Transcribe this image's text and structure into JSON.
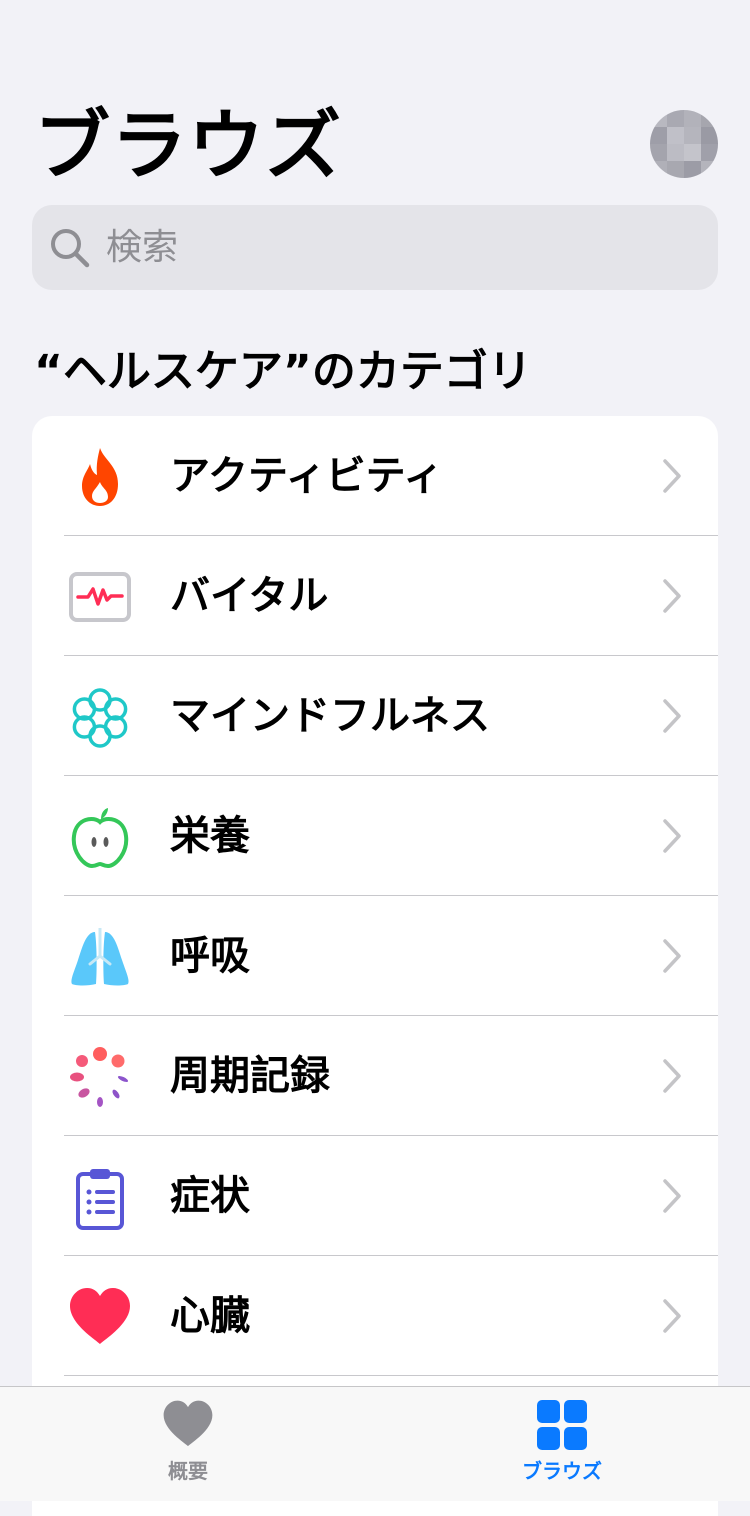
{
  "header": {
    "title": "ブラウズ",
    "avatar_colors": [
      "#b8b8c0",
      "#a9a9b2",
      "#b2b2ba",
      "#a6a6ae",
      "#9e9ea8",
      "#c0c0c8",
      "#b5b5bd",
      "#9a9aa4",
      "#a4a4ad",
      "#bcbcc4",
      "#c4c4cb",
      "#a0a0aa",
      "#b0b0b8",
      "#a8a8b0",
      "#9c9ca6",
      "#b4b4bc"
    ]
  },
  "search": {
    "placeholder": "検索",
    "value": ""
  },
  "section": {
    "title": "“ヘルスケア”のカテゴリ"
  },
  "categories": [
    {
      "label": "アクティビティ",
      "icon": "flame-icon",
      "color": "#ff3b00"
    },
    {
      "label": "バイタル",
      "icon": "vitals-monitor-icon",
      "color": "#ff2d55"
    },
    {
      "label": "マインドフルネス",
      "icon": "mindfulness-flower-icon",
      "color": "#1fc8c8"
    },
    {
      "label": "栄養",
      "icon": "apple-icon",
      "color": "#34c759"
    },
    {
      "label": "呼吸",
      "icon": "lungs-icon",
      "color": "#5ac8fa"
    },
    {
      "label": "周期記録",
      "icon": "cycle-tracking-icon",
      "color": "#ff5e6a"
    },
    {
      "label": "症状",
      "icon": "clipboard-icon",
      "color": "#5856d6"
    },
    {
      "label": "心臓",
      "icon": "heart-icon",
      "color": "#ff2d55"
    },
    {
      "label": "",
      "icon": "",
      "color": ""
    }
  ],
  "tabbar": {
    "tabs": [
      {
        "label": "概要",
        "icon": "heart-icon",
        "color": "#8e8e93",
        "selected": false
      },
      {
        "label": "ブラウズ",
        "icon": "grid-icon",
        "color": "#0a7aff",
        "selected": true
      }
    ]
  }
}
